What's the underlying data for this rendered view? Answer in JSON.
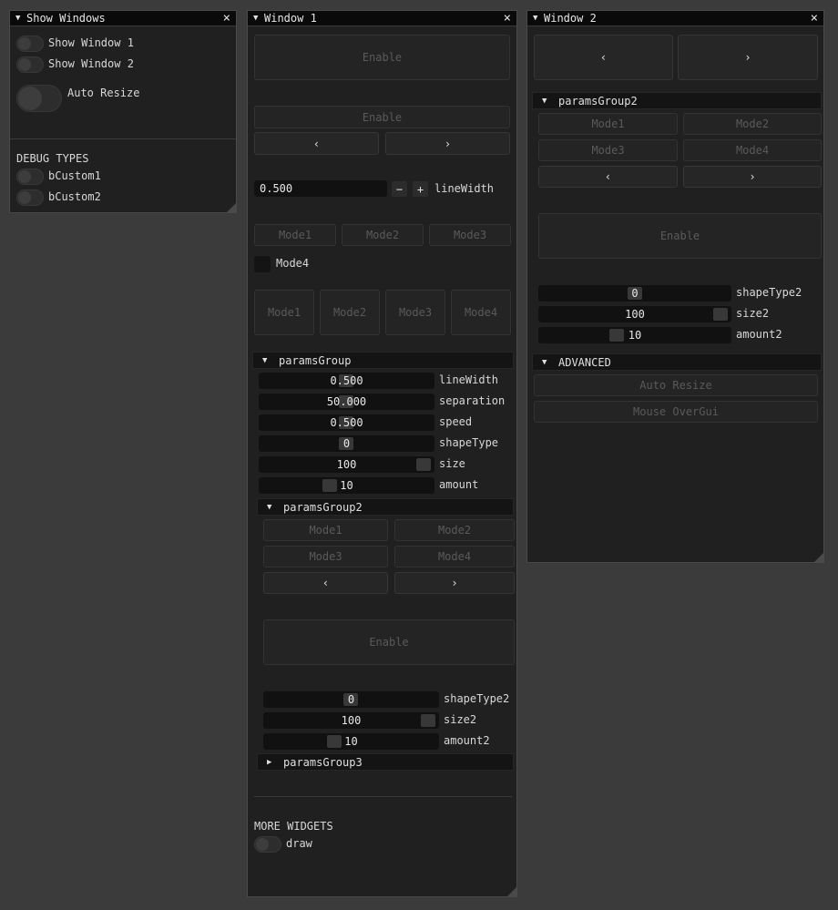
{
  "show_windows": {
    "title": "Show Windows",
    "close": "×",
    "collapse": "▼",
    "toggles": [
      "Show Window 1",
      "Show Window 2"
    ],
    "auto_resize": "Auto Resize",
    "debug_header": "DEBUG TYPES",
    "debug_toggles": [
      "bCustom1",
      "bCustom2"
    ]
  },
  "window1": {
    "title": "Window 1",
    "close": "×",
    "collapse": "▼",
    "enable_big": "Enable",
    "enable_small": "Enable",
    "prev": "‹",
    "next": "›",
    "linewidth_input": "0.500",
    "minus": "−",
    "plus": "+",
    "linewidth_label": "lineWidth",
    "modes_row": [
      "Mode1",
      "Mode2",
      "Mode3"
    ],
    "mode4_label": "Mode4",
    "modes_tall": [
      "Mode1",
      "Mode2",
      "Mode3",
      "Mode4"
    ],
    "params_group": {
      "title": "paramsGroup",
      "arrow": "▼",
      "sliders": [
        {
          "value": "0.500",
          "label": "lineWidth",
          "fraction": 0.5
        },
        {
          "value": "50.000",
          "label": "separation",
          "fraction": 0.5
        },
        {
          "value": "0.500",
          "label": "speed",
          "fraction": 0.5
        },
        {
          "value": "0",
          "label": "shapeType",
          "fraction": 0.5
        },
        {
          "value": "100",
          "label": "size",
          "fraction": 1.0
        },
        {
          "value": "10",
          "label": "amount",
          "fraction": 0.4
        }
      ]
    },
    "params_group2": {
      "title": "paramsGroup2",
      "arrow": "▼",
      "modes": [
        "Mode1",
        "Mode2",
        "Mode3",
        "Mode4"
      ],
      "prev": "‹",
      "next": "›",
      "enable": "Enable",
      "sliders": [
        {
          "value": "0",
          "label": "shapeType2"
        },
        {
          "value": "100",
          "label": "size2"
        },
        {
          "value": "10",
          "label": "amount2"
        }
      ]
    },
    "params_group3": {
      "title": "paramsGroup3",
      "arrow": "▶"
    },
    "more_widgets": "MORE WIDGETS",
    "draw_label": "draw"
  },
  "window2": {
    "title": "Window 2",
    "close": "×",
    "collapse": "▼",
    "prev": "‹",
    "next": "›",
    "params_group2": {
      "title": "paramsGroup2",
      "arrow": "▼",
      "modes": [
        "Mode1",
        "Mode2",
        "Mode3",
        "Mode4"
      ],
      "prev": "‹",
      "next": "›",
      "enable": "Enable",
      "sliders": [
        {
          "value": "0",
          "label": "shapeType2"
        },
        {
          "value": "100",
          "label": "size2"
        },
        {
          "value": "10",
          "label": "amount2"
        }
      ]
    },
    "advanced": {
      "title": "ADVANCED",
      "arrow": "▼",
      "auto_resize": "Auto Resize",
      "mouse_over_gui": "Mouse OverGui"
    }
  }
}
